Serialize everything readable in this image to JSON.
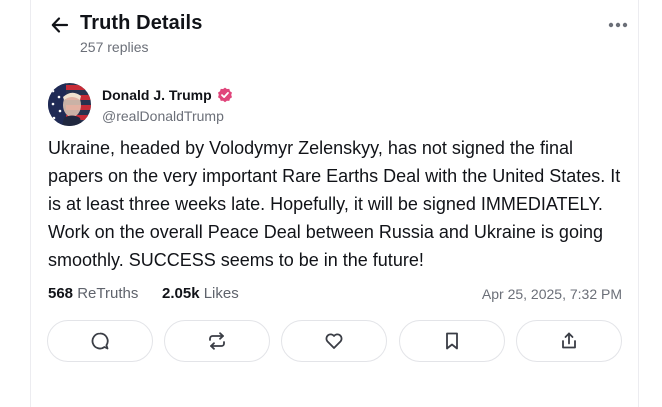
{
  "header": {
    "title": "Truth Details",
    "replies": "257 replies"
  },
  "post": {
    "author_name": "Donald J. Trump",
    "handle": "@realDonaldTrump",
    "text": "Ukraine, headed by Volodymyr Zelenskyy, has not signed the final papers on the very important Rare Earths Deal with the United States. It is at least three weeks late. Hopefully, it will be signed IMMEDIATELY. Work on the overall Peace Deal between Russia and Ukraine is going smoothly. SUCCESS seems to be in the future!",
    "retruths_count": "568",
    "retruths_label": "ReTruths",
    "likes_count": "2.05k",
    "likes_label": "Likes",
    "timestamp": "Apr 25, 2025, 7:32 PM"
  },
  "icons": {
    "back": "arrow-left-icon",
    "more": "more-horizontal-icon",
    "verified": "verified-badge-icon",
    "reply": "comment-icon",
    "retruth": "repost-icon",
    "like": "heart-icon",
    "bookmark": "bookmark-icon",
    "share": "share-icon"
  },
  "colors": {
    "verified": "#e0457b",
    "text": "#111318",
    "muted": "#6b6f78",
    "border": "#e3e4e8"
  }
}
